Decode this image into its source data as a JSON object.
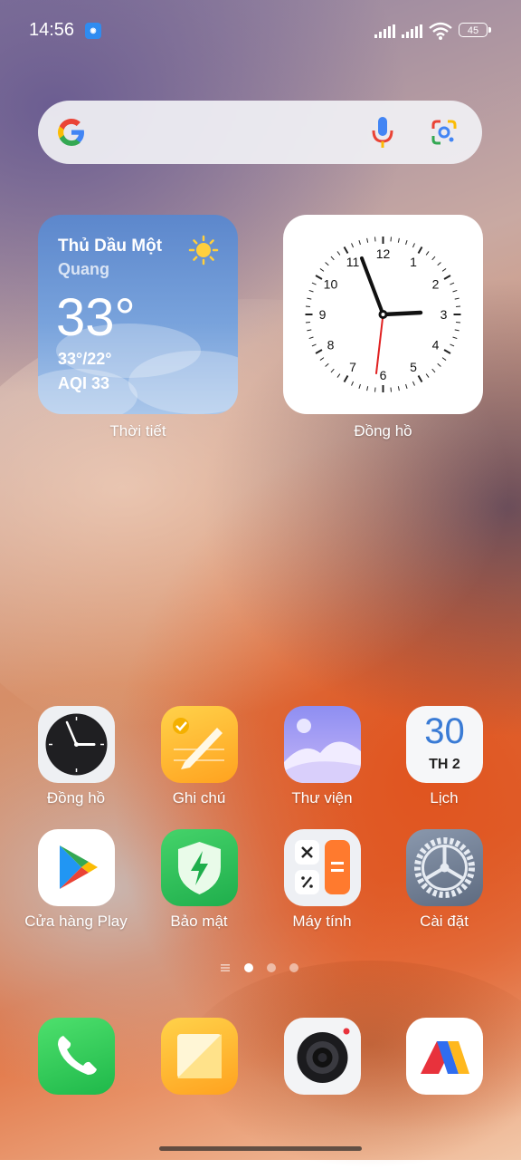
{
  "status_bar": {
    "time": "14:56",
    "battery": "45"
  },
  "search": {
    "placeholder": ""
  },
  "weather": {
    "city": "Thủ Dầu Một",
    "condition": "Quang",
    "temp": "33°",
    "range": "33°/22°",
    "aqi": "AQI 33",
    "label": "Thời tiết"
  },
  "clock_widget": {
    "label": "Đồng hồ",
    "numbers": [
      "12",
      "1",
      "2",
      "3",
      "4",
      "5",
      "6",
      "7",
      "8",
      "9",
      "10",
      "11"
    ]
  },
  "apps_row1": [
    {
      "label": "Đồng hồ"
    },
    {
      "label": "Ghi chú"
    },
    {
      "label": "Thư viện"
    },
    {
      "label": "Lịch",
      "day": "30",
      "weekday": "TH 2"
    }
  ],
  "apps_row2": [
    {
      "label": "Cửa hàng Play"
    },
    {
      "label": "Bảo mật"
    },
    {
      "label": "Máy tính"
    },
    {
      "label": "Cài đặt"
    }
  ],
  "dock": [
    {
      "icon": "phone-icon"
    },
    {
      "icon": "notes-icon"
    },
    {
      "icon": "camera-icon"
    },
    {
      "icon": "app-vault-icon"
    }
  ],
  "page_indicator": {
    "pages": 3,
    "current": 1
  }
}
